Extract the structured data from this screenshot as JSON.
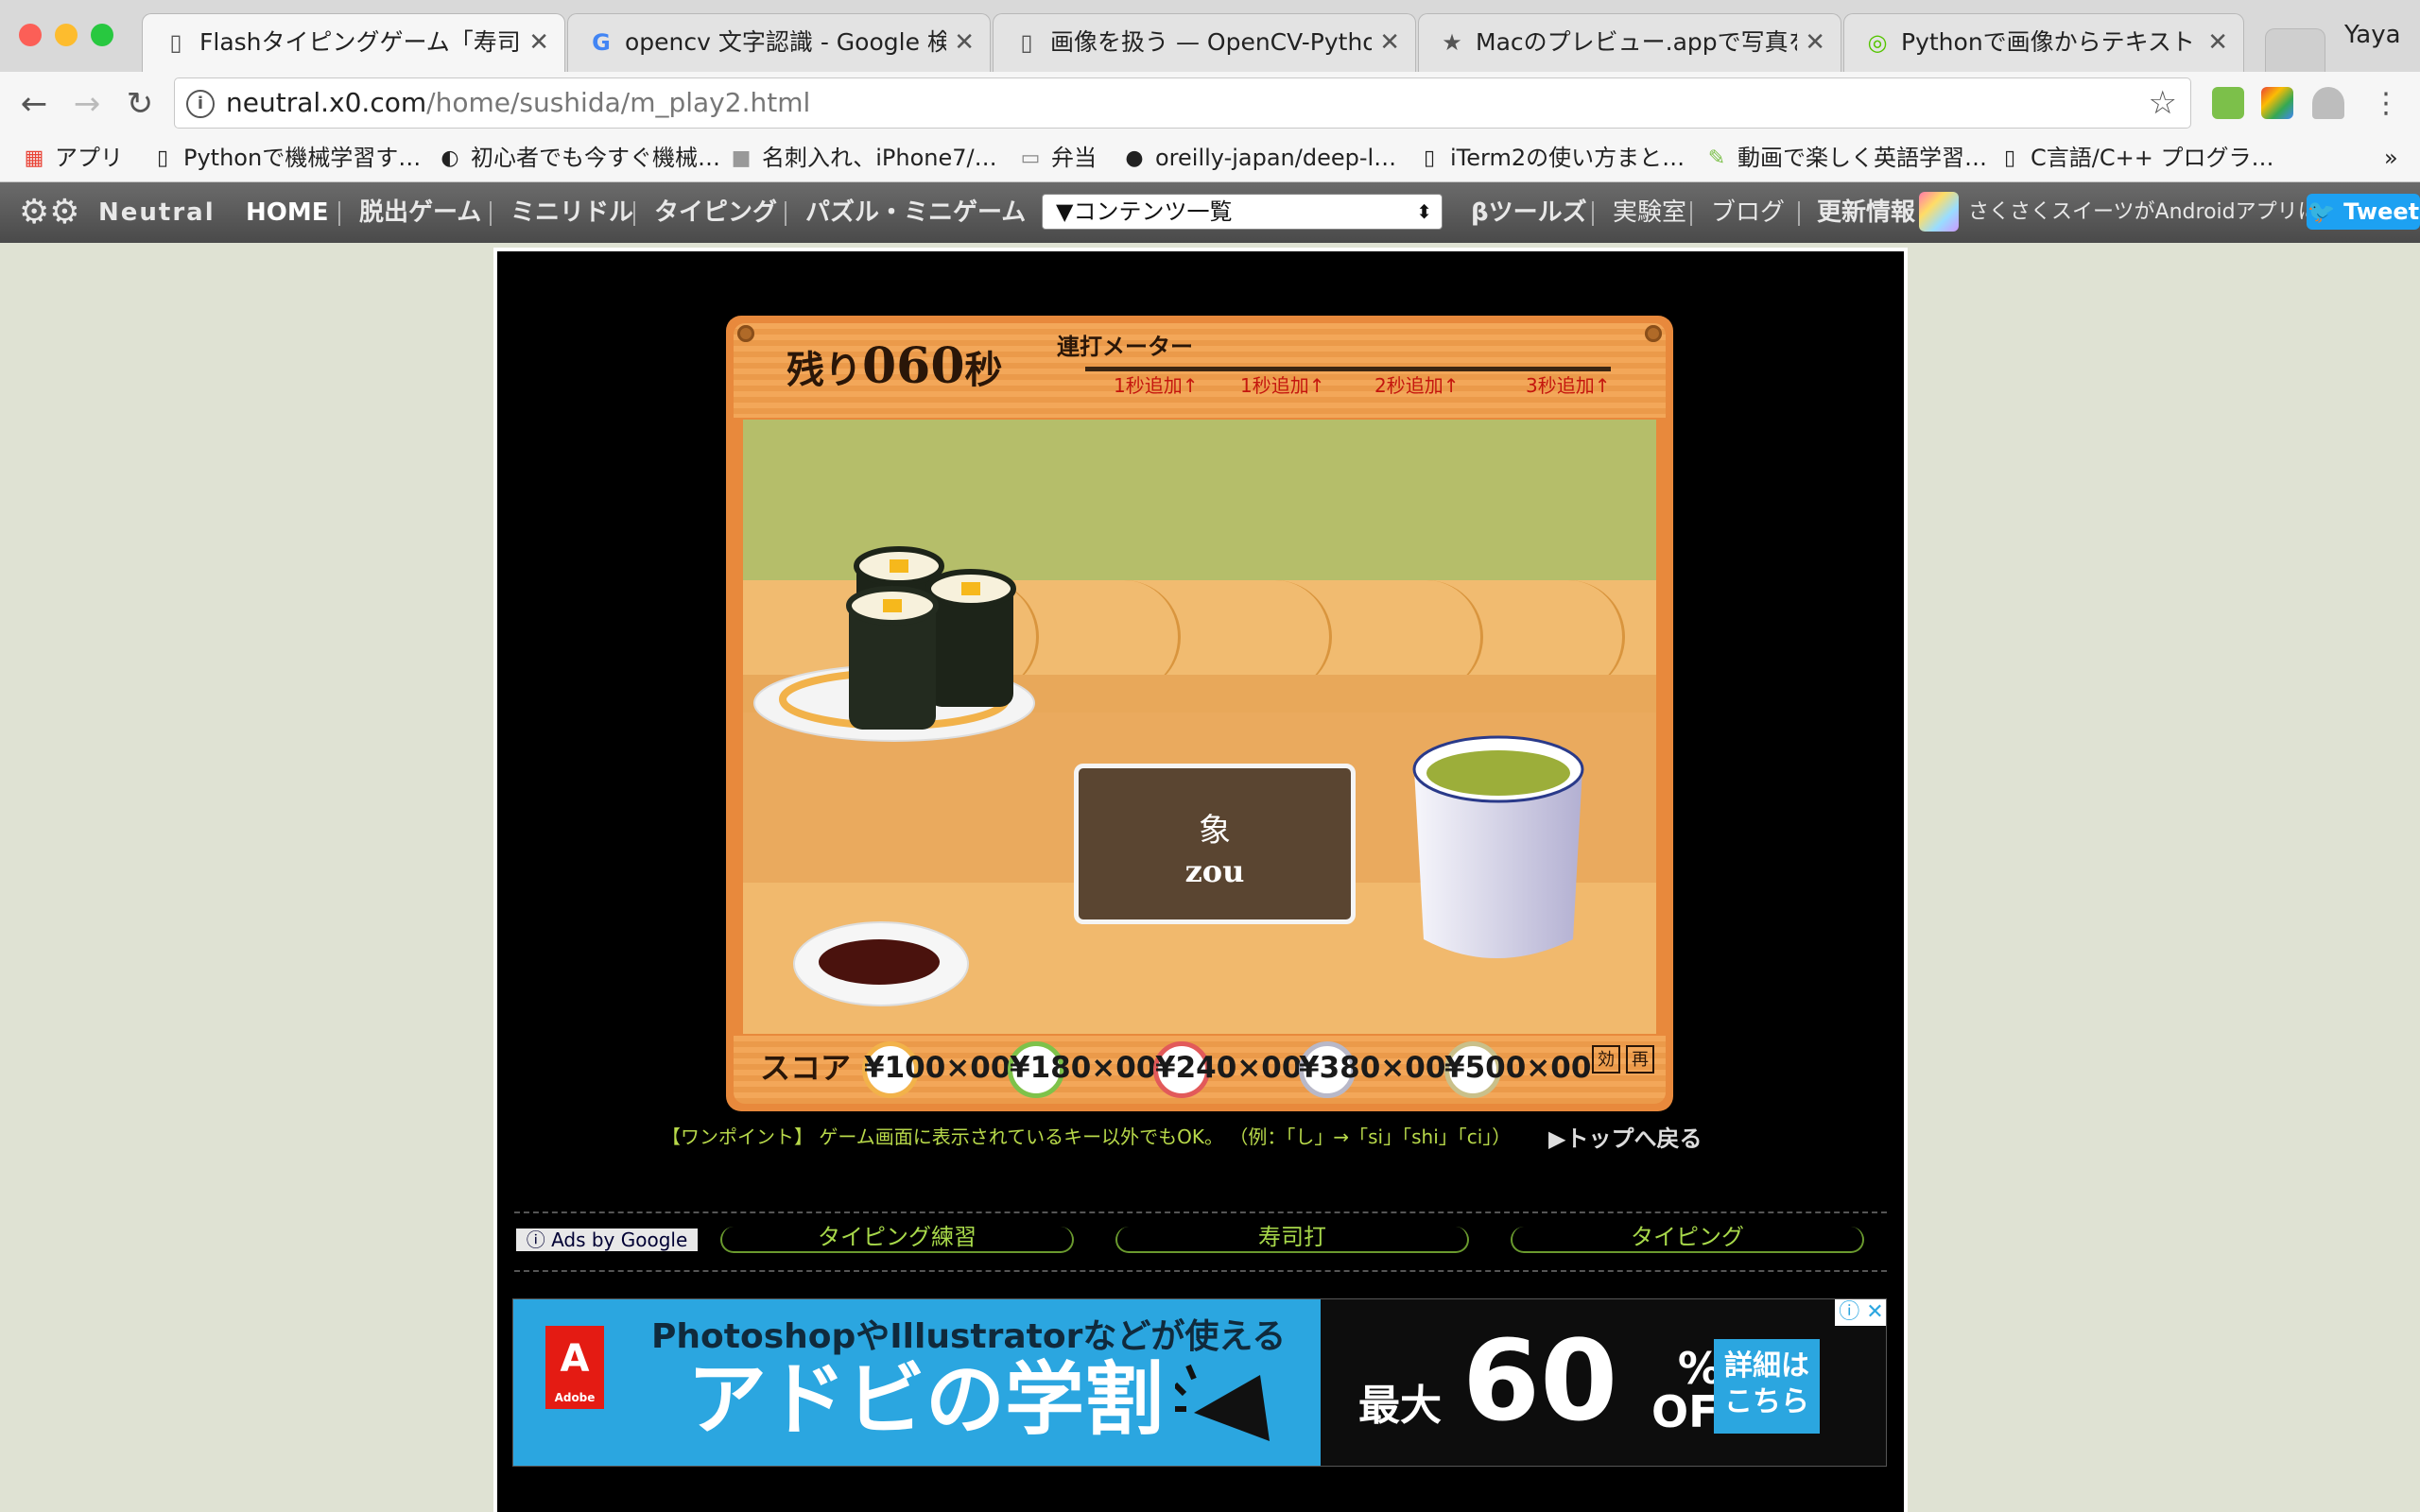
{
  "browser": {
    "tabs": [
      {
        "title": "Flashタイピングゲーム「寿司打」",
        "icon": "page-icon",
        "active": true
      },
      {
        "title": "opencv 文字認識 - Google 検索",
        "icon": "google-icon"
      },
      {
        "title": "画像を扱う — OpenCV-Python",
        "icon": "page-icon"
      },
      {
        "title": "Macのプレビュー.appで写真を",
        "icon": "star-icon"
      },
      {
        "title": "Pythonで画像からテキストを抽出",
        "icon": "qiita-icon"
      }
    ],
    "profile": "Yaya",
    "url_host": "neutral.x0.com",
    "url_path": "/home/sushida/m_play2.html",
    "bookmarks": [
      {
        "label": "アプリ",
        "icon": "apps-icon"
      },
      {
        "label": "Pythonで機械学習す…",
        "icon": "page-icon"
      },
      {
        "label": "初心者でも今すぐ機械…",
        "icon": "page-icon"
      },
      {
        "label": "名刺入れ、iPhone7/…",
        "icon": "box-icon"
      },
      {
        "label": "弁当",
        "icon": "folder-icon"
      },
      {
        "label": "oreilly-japan/deep-l…",
        "icon": "github-icon"
      },
      {
        "label": "iTerm2の使い方まと…",
        "icon": "page-icon"
      },
      {
        "label": "動画で楽しく英語学習…",
        "icon": "edit-icon"
      },
      {
        "label": "C言語/C++ プログラ…",
        "icon": "page-icon"
      }
    ],
    "more": "»"
  },
  "site": {
    "logo": "Neutral",
    "nav": [
      "HOME",
      "脱出ゲーム",
      "ミニリドル",
      "タイピング",
      "パズル・ミニゲーム"
    ],
    "content_select": "▼コンテンツ一覧",
    "nav2": [
      "βツールズ",
      "実験室",
      "ブログ",
      "更新情報"
    ],
    "news": "さくさくスイーツがAndroidアプリに",
    "tweet": "Tweet"
  },
  "game": {
    "timer_prefix": "残り",
    "timer_value": "060",
    "timer_suffix": "秒",
    "meter_label": "連打メーター",
    "meter_marks": [
      "1秒追加",
      "1秒追加",
      "2秒追加",
      "3秒追加"
    ],
    "word_kanji": "象",
    "word_romaji": "zou",
    "score_label": "スコア",
    "coins": [
      {
        "price": "¥100",
        "count": "×00",
        "color": "#f2b24a"
      },
      {
        "price": "¥180",
        "count": "×00",
        "color": "#7ec24a"
      },
      {
        "price": "¥240",
        "count": "×00",
        "color": "#e25a5a"
      },
      {
        "price": "¥380",
        "count": "×00",
        "color": "#b8b8c8"
      },
      {
        "price": "¥500",
        "count": "×00",
        "color": "#c9c08a"
      }
    ],
    "sound_buttons": [
      "効",
      "再"
    ]
  },
  "tip": "【ワンポイント】 ゲーム画面に表示されているキー以外でもOK。 （例：「し」→「si」「shi」「ci」）",
  "back_to_top": "▶トップへ戻る",
  "ads": {
    "ads_by": "Ads by Google",
    "links": [
      "タイピング練習",
      "寿司打",
      "タイピング"
    ],
    "banner_line1": "PhotoshopやIllustratorなどが使える",
    "banner_line2": "アドビの学割",
    "banner_max": "最大",
    "banner_big": "60",
    "banner_pct": "%\nOFF",
    "banner_detail": "詳細は\nこちら",
    "adobe": "Adobe"
  }
}
